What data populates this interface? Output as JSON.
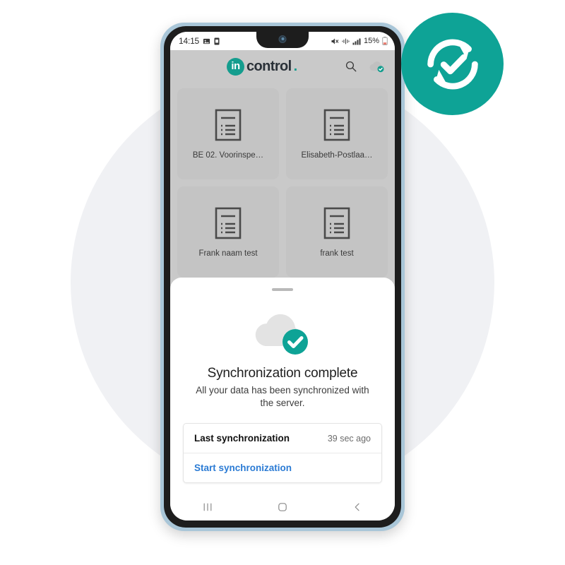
{
  "scene": {
    "backdrop_color": "#f0f1f4",
    "accent_color": "#0ea396",
    "phone_frame_color": "#a9c6d8"
  },
  "status_bar": {
    "time": "14:15",
    "left_icons": [
      "image-icon",
      "sim-card-icon"
    ],
    "right_icons": [
      "mute-icon",
      "wifi-icon",
      "signal-bars-icon"
    ],
    "battery_percent": "15%"
  },
  "app_header": {
    "logo_mark": "in",
    "logo_text": "control",
    "logo_dot": ".",
    "search_icon": "search-icon",
    "cloud_sync_icon": "cloud-check-icon"
  },
  "tiles": [
    {
      "label": "BE 02. Voorinspe…",
      "icon": "document-icon"
    },
    {
      "label": "Elisabeth-Postlaa…",
      "icon": "document-icon"
    },
    {
      "label": "Frank naam test",
      "icon": "document-icon"
    },
    {
      "label": "frank test",
      "icon": "document-icon"
    }
  ],
  "sheet": {
    "handle": "drag-handle",
    "illustration": "cloud-check-icon",
    "title": "Synchronization complete",
    "subtitle": "All your data has been synchronized with the server.",
    "rows": [
      {
        "label": "Last synchronization",
        "value": "39 sec ago"
      }
    ],
    "action_label": "Start synchronization"
  },
  "nav_bar": {
    "recents": "recents-icon",
    "home": "home-icon",
    "back": "back-icon"
  },
  "badge": {
    "icon": "sync-check-icon",
    "color": "#0ea396"
  }
}
